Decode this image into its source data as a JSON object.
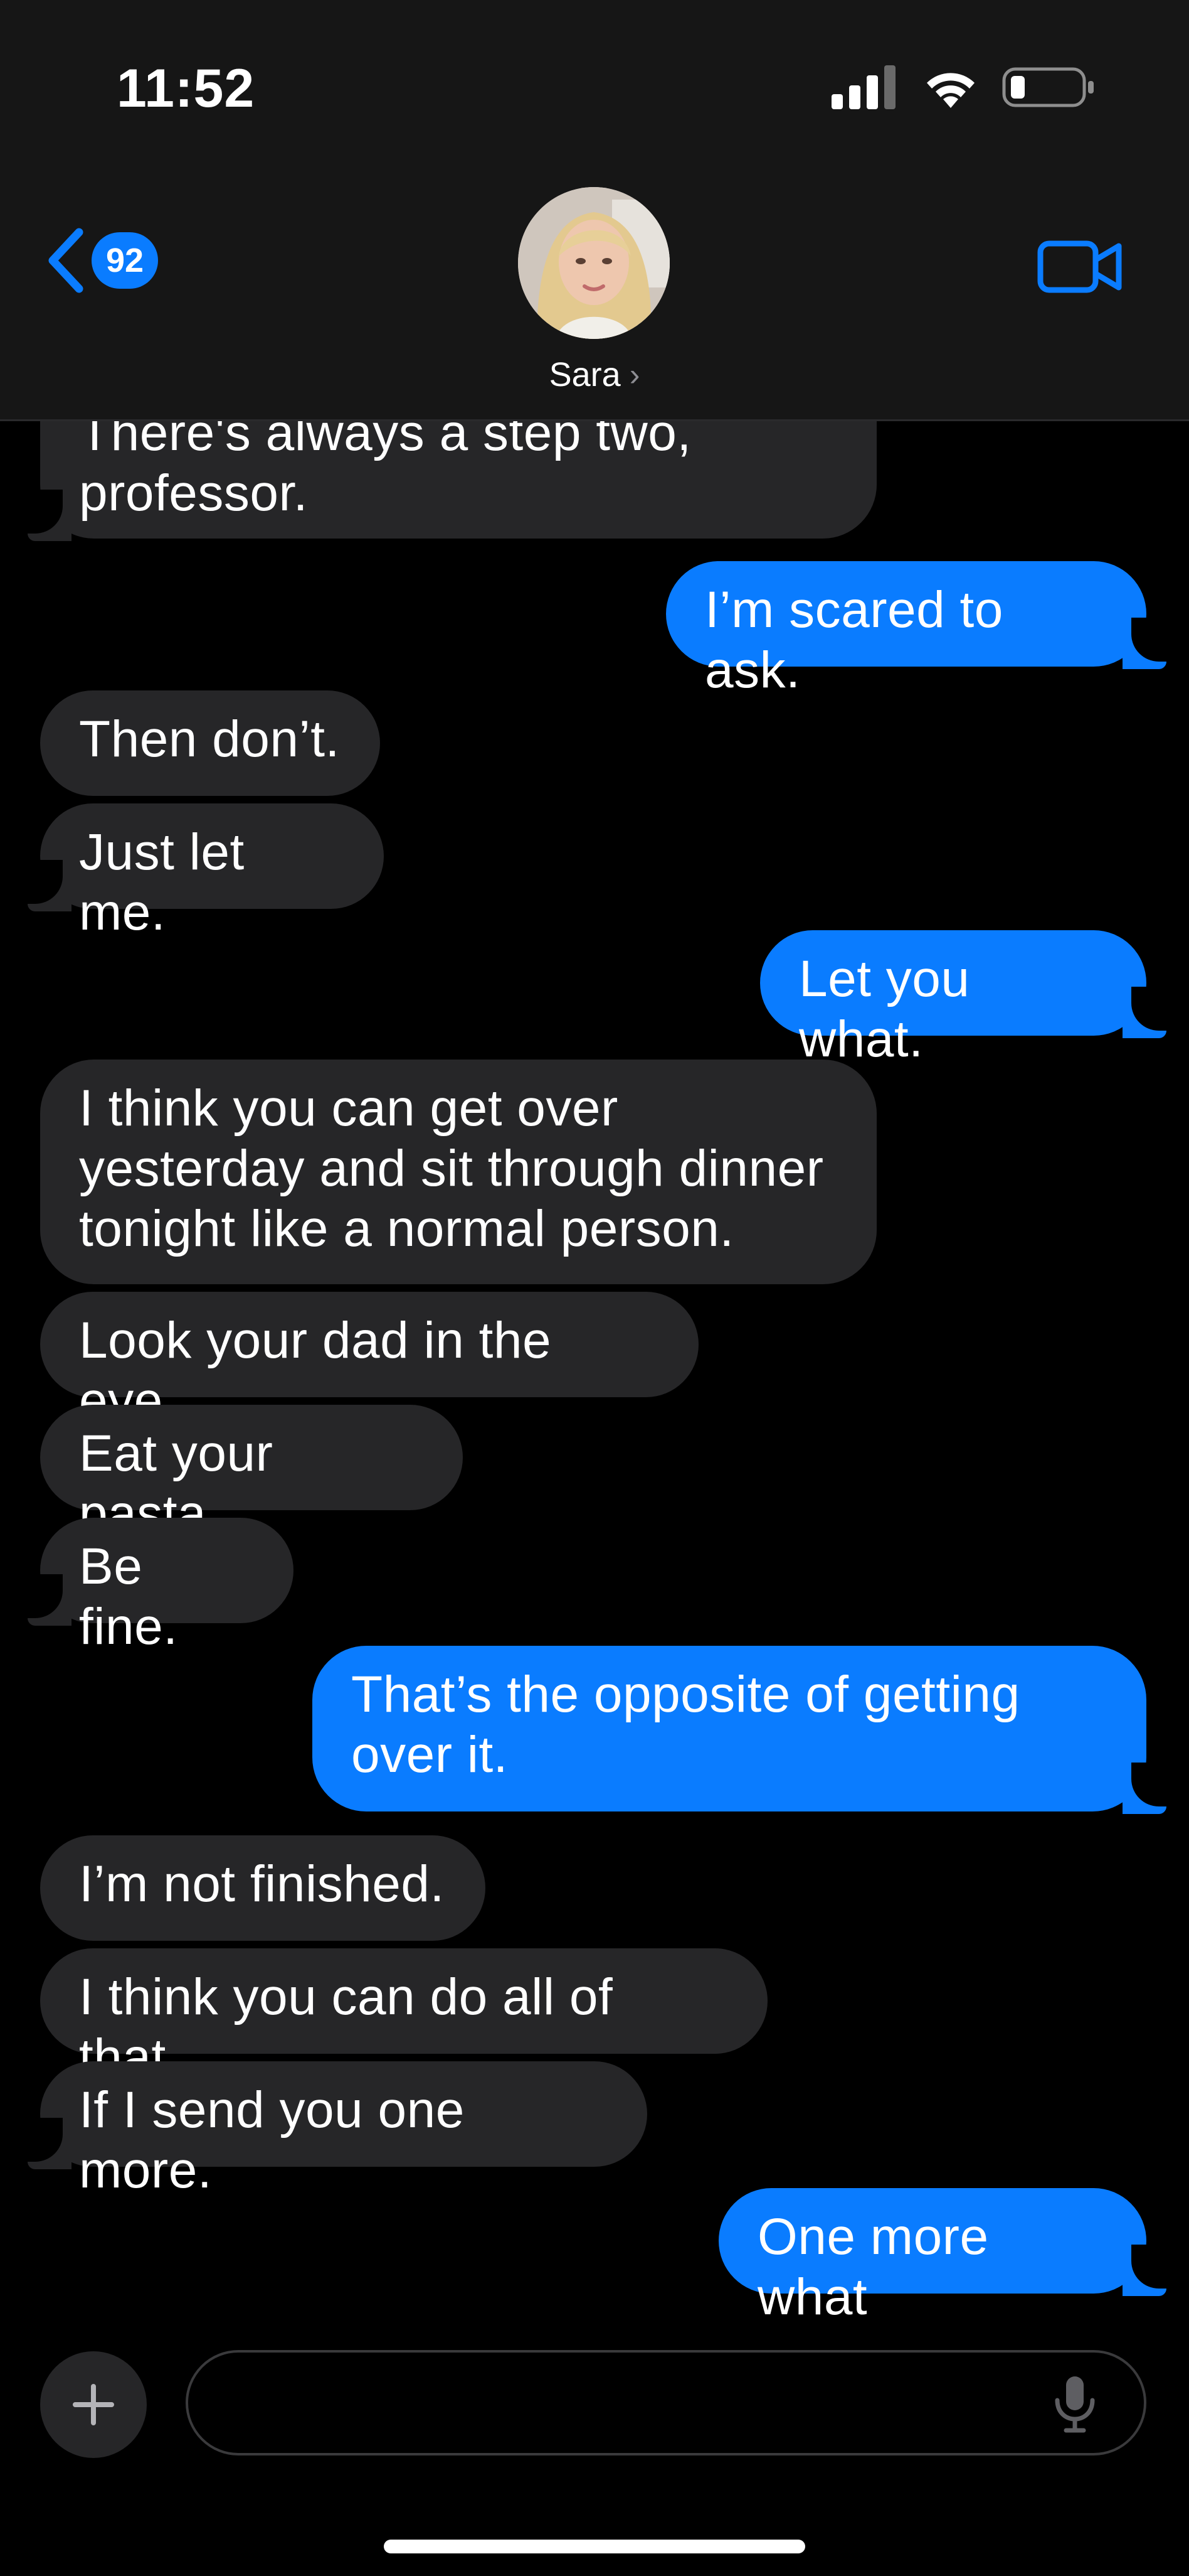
{
  "status_bar": {
    "time": "11:52",
    "signal_icon": "cellular-signal-icon",
    "wifi_icon": "wifi-icon",
    "battery_icon": "battery-low-icon"
  },
  "header": {
    "back_icon": "chevron-left-icon",
    "unread_count": "92",
    "contact_name": "Sara",
    "contact_chevron": "›",
    "video_icon": "video-camera-icon",
    "accent_color": "#0a7cff"
  },
  "messages": [
    {
      "from": "contact",
      "text": "There's always a step two,\nprofessor."
    },
    {
      "from": "me",
      "text": "I’m scared to ask."
    },
    {
      "from": "contact",
      "text": "Then don’t."
    },
    {
      "from": "contact",
      "text": "Just let me."
    },
    {
      "from": "me",
      "text": "Let you what."
    },
    {
      "from": "contact",
      "text": "I think you can get over\nyesterday and sit through dinner\ntonight like a normal person."
    },
    {
      "from": "contact",
      "text": "Look your dad in the eye."
    },
    {
      "from": "contact",
      "text": "Eat your pasta."
    },
    {
      "from": "contact",
      "text": "Be fine."
    },
    {
      "from": "me",
      "text": "That’s the opposite of getting\nover it."
    },
    {
      "from": "contact",
      "text": "I’m not finished."
    },
    {
      "from": "contact",
      "text": "I think you can do all of that."
    },
    {
      "from": "contact",
      "text": "If I send you one more."
    },
    {
      "from": "me",
      "text": "One more what"
    }
  ],
  "composer": {
    "plus_icon": "plus-icon",
    "input_value": "",
    "mic_icon": "microphone-icon"
  },
  "colors": {
    "incoming_bubble": "#262628",
    "outgoing_bubble": "#0a7cff",
    "background": "#000000",
    "header_background": "#161616"
  }
}
